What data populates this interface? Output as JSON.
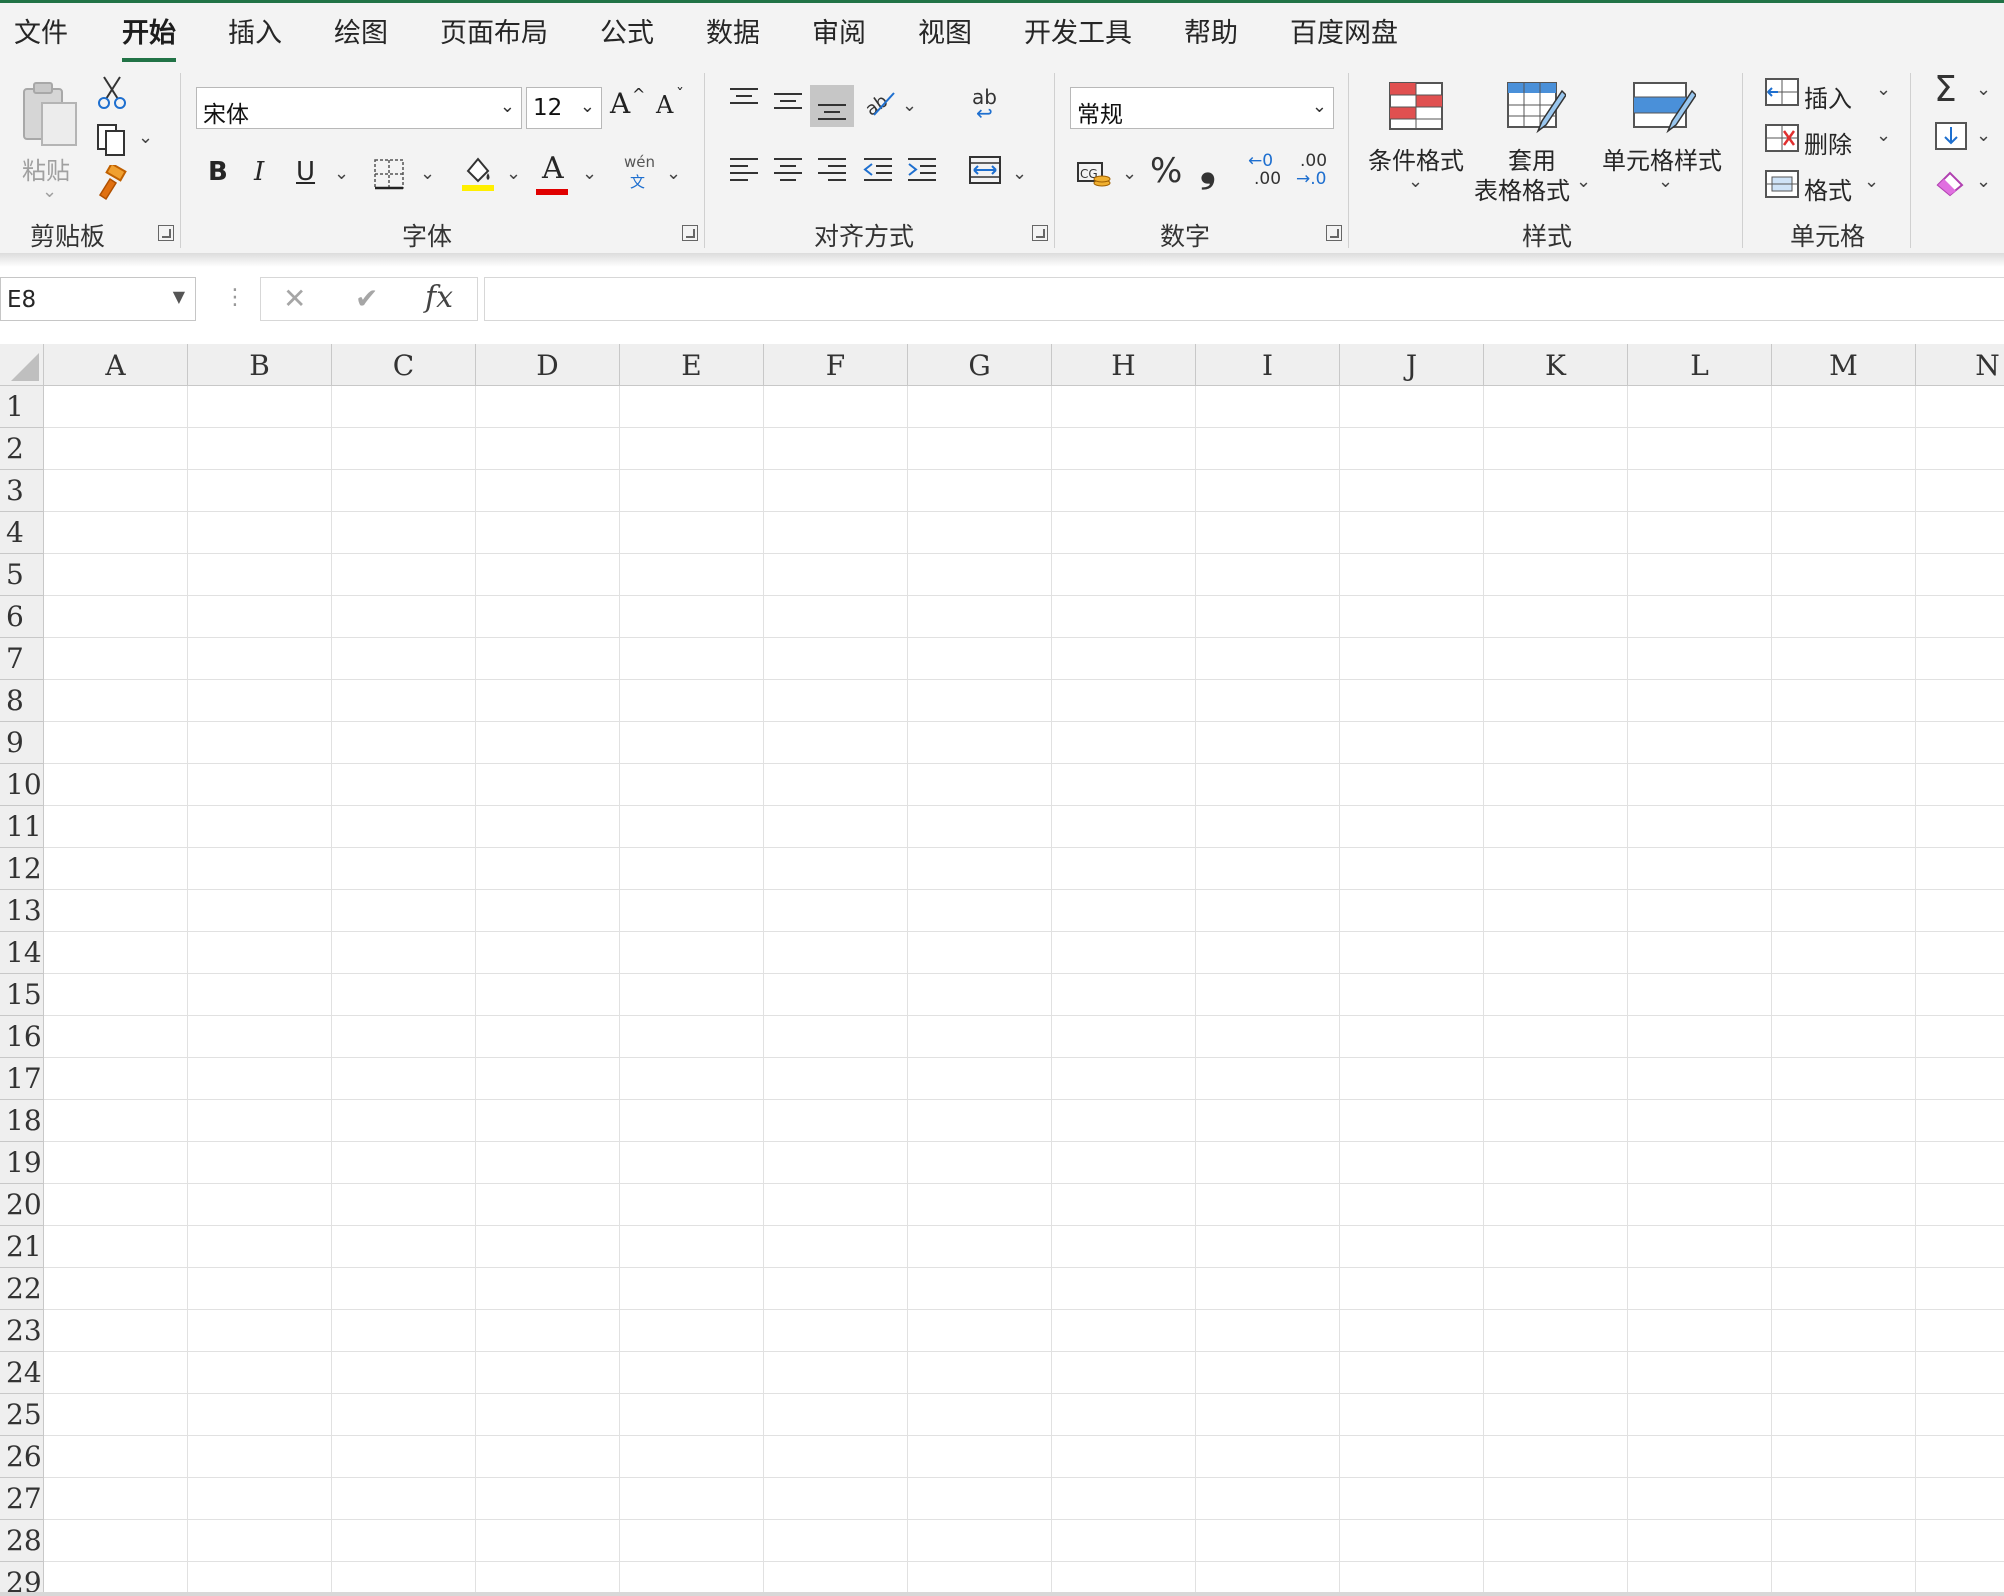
{
  "menu": {
    "tabs": [
      "文件",
      "开始",
      "插入",
      "绘图",
      "页面布局",
      "公式",
      "数据",
      "审阅",
      "视图",
      "开发工具",
      "帮助",
      "百度网盘"
    ],
    "active_tab": "开始"
  },
  "ribbon": {
    "clipboard": {
      "paste": "粘贴",
      "group": "剪贴板"
    },
    "font": {
      "name": "宋体",
      "size": "12",
      "bold": "B",
      "italic": "I",
      "underline": "U",
      "font_color_glyph": "A",
      "phonetic_top": "wén",
      "phonetic_bottom": "文",
      "group": "字体",
      "grow": "A",
      "shrink": "A",
      "fill_color": "#ffef00",
      "font_color": "#e00000"
    },
    "alignment": {
      "group": "对齐方式",
      "wrap": "ab"
    },
    "number": {
      "format": "常规",
      "group": "数字",
      "percent": "%",
      "comma": "❟",
      "inc_top": "←0",
      "inc_bottom": ".00",
      "dec_top": ".00",
      "dec_bottom": "→.0"
    },
    "styles": {
      "conditional": "条件格式",
      "table_line1": "套用",
      "table_line2": "表格格式",
      "cell_styles": "单元格样式",
      "group": "样式"
    },
    "cells": {
      "insert": "插入",
      "delete": "删除",
      "format": "格式",
      "group": "单元格"
    },
    "editing": {
      "sum": "Σ"
    }
  },
  "formula_bar": {
    "name_box": "E8",
    "cancel": "✕",
    "enter": "✔",
    "fx": "fx",
    "content": ""
  },
  "sheet": {
    "columns": [
      "A",
      "B",
      "C",
      "D",
      "E",
      "F",
      "G",
      "H",
      "I",
      "J",
      "K",
      "L",
      "M",
      "N"
    ],
    "rows": [
      "1",
      "2",
      "3",
      "4",
      "5",
      "6",
      "7",
      "8",
      "9",
      "10",
      "11",
      "12",
      "13",
      "14",
      "15",
      "16",
      "17",
      "18",
      "19",
      "20",
      "21",
      "22",
      "23",
      "24",
      "25",
      "26",
      "27",
      "28",
      "29"
    ],
    "accent_color": "#217346"
  }
}
